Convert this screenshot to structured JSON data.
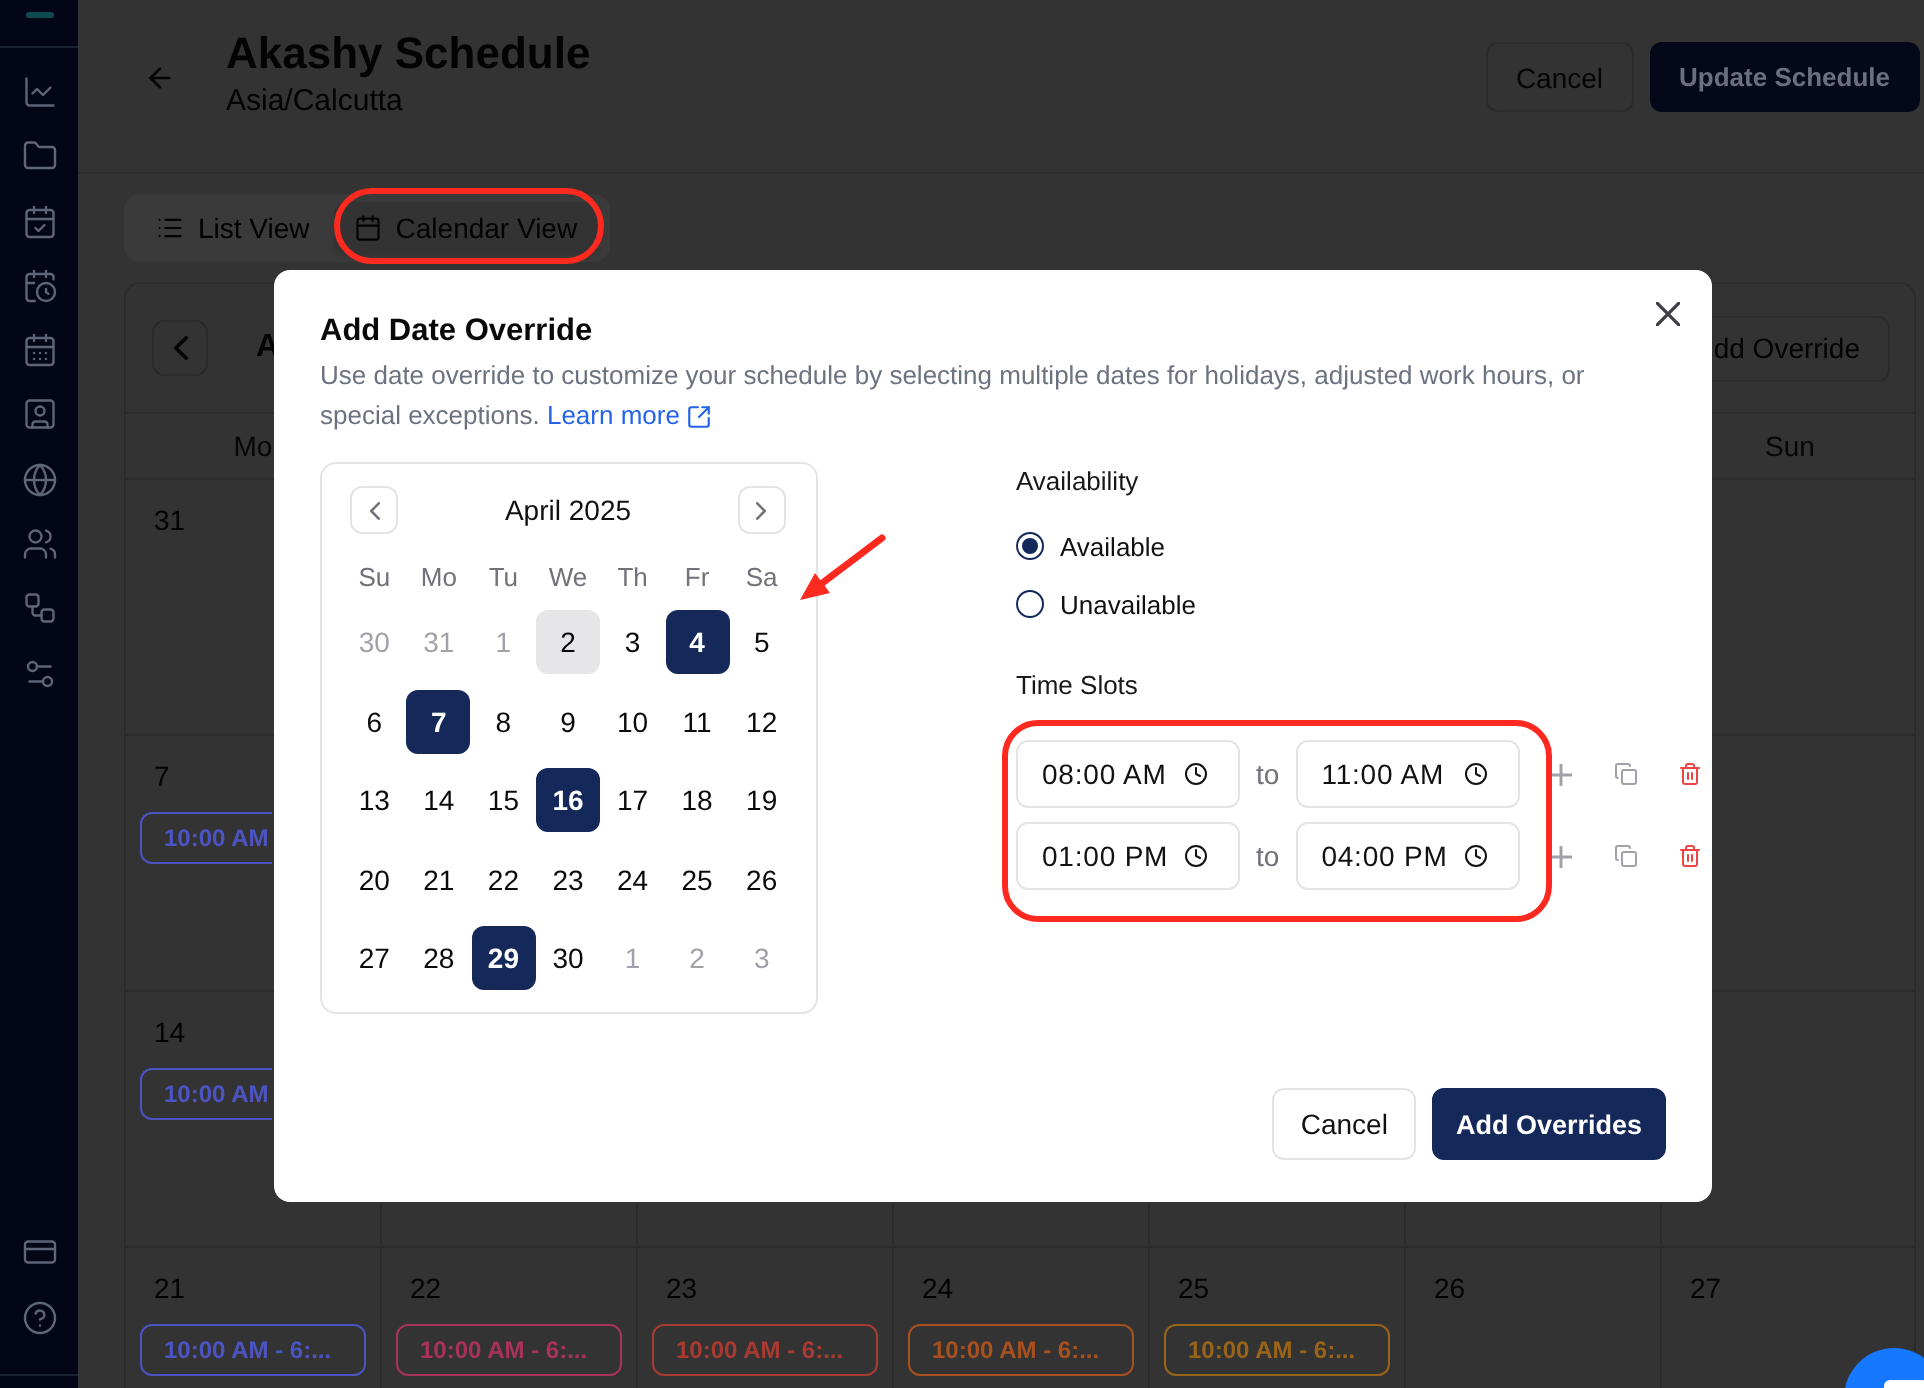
{
  "header": {
    "title": "Akashy Schedule",
    "subtitle": "Asia/Calcutta",
    "buttons": [
      {
        "label": "Cancel",
        "kind": "secondary"
      },
      {
        "label": "Update Schedule",
        "kind": "primary"
      }
    ]
  },
  "view_tabs": [
    {
      "label": "List View",
      "selected": false,
      "circled": false
    },
    {
      "label": "Calendar View",
      "selected": true,
      "circled": true
    }
  ],
  "calendar": {
    "month_title": "A",
    "add_button": "dd Override",
    "weekday_headers": [
      {
        "label": "Mo"
      },
      {
        "label": "Sun"
      }
    ],
    "weeks": [
      {
        "cells": [
          {
            "date": "31"
          },
          {},
          {},
          {},
          {},
          {},
          {}
        ]
      },
      {
        "cells": [
          {
            "date": "7",
            "events": [
              {
                "text": "10:00 AM",
                "color": "#4c54c4",
                "clipped": true
              }
            ]
          },
          {},
          {},
          {},
          {},
          {},
          {}
        ]
      },
      {
        "cells": [
          {
            "date": "14",
            "events": [
              {
                "text": "10:00 AM",
                "color": "#4c54c4",
                "clipped": true
              }
            ]
          },
          {},
          {},
          {},
          {},
          {},
          {}
        ]
      },
      {
        "cells": [
          {
            "date": "21",
            "events": [
              {
                "text": "10:00 AM - 6:...",
                "color": "#4c54c4",
                "clipped": false
              }
            ]
          },
          {
            "date": "22",
            "events": [
              {
                "text": "10:00 AM - 6:...",
                "color": "#a8325a",
                "clipped": false
              }
            ]
          },
          {
            "date": "23",
            "events": [
              {
                "text": "10:00 AM - 6:...",
                "color": "#a83a32",
                "clipped": false
              }
            ]
          },
          {
            "date": "24",
            "events": [
              {
                "text": "10:00 AM - 6:...",
                "color": "#a8501e",
                "clipped": false
              }
            ]
          },
          {
            "date": "25",
            "events": [
              {
                "text": "10:00 AM - 6:...",
                "color": "#9a6418",
                "clipped": false
              }
            ]
          },
          {
            "date": "26"
          },
          {
            "date": "27"
          }
        ]
      }
    ]
  },
  "dialog": {
    "title": "Add Date Override",
    "description": "Use date override to customize your schedule by selecting multiple dates for holidays, adjusted work hours, or special exceptions.",
    "link": "Learn more",
    "date_picker": {
      "month": "April 2025",
      "arrow": true,
      "weekdays": [
        "Su",
        "Mo",
        "Tu",
        "We",
        "Th",
        "Fr",
        "Sa"
      ],
      "weeks": [
        {
          "days": [
            {
              "label": "30",
              "outside": true,
              "today": false,
              "selected": false
            },
            {
              "label": "31",
              "outside": true,
              "today": false,
              "selected": false
            },
            {
              "label": "1",
              "outside": true,
              "today": false,
              "selected": false
            },
            {
              "label": "2",
              "outside": false,
              "today": true,
              "selected": false
            },
            {
              "label": "3",
              "outside": false,
              "today": false,
              "selected": false
            },
            {
              "label": "4",
              "outside": false,
              "today": false,
              "selected": true
            },
            {
              "label": "5",
              "outside": false,
              "today": false,
              "selected": false
            }
          ]
        },
        {
          "days": [
            {
              "label": "6",
              "outside": false,
              "today": false,
              "selected": false
            },
            {
              "label": "7",
              "outside": false,
              "today": false,
              "selected": true
            },
            {
              "label": "8",
              "outside": false,
              "today": false,
              "selected": false
            },
            {
              "label": "9",
              "outside": false,
              "today": false,
              "selected": false
            },
            {
              "label": "10",
              "outside": false,
              "today": false,
              "selected": false
            },
            {
              "label": "11",
              "outside": false,
              "today": false,
              "selected": false
            },
            {
              "label": "12",
              "outside": false,
              "today": false,
              "selected": false
            }
          ]
        },
        {
          "days": [
            {
              "label": "13",
              "outside": false,
              "today": false,
              "selected": false
            },
            {
              "label": "14",
              "outside": false,
              "today": false,
              "selected": false
            },
            {
              "label": "15",
              "outside": false,
              "today": false,
              "selected": false
            },
            {
              "label": "16",
              "outside": false,
              "today": false,
              "selected": true
            },
            {
              "label": "17",
              "outside": false,
              "today": false,
              "selected": false
            },
            {
              "label": "18",
              "outside": false,
              "today": false,
              "selected": false
            },
            {
              "label": "19",
              "outside": false,
              "today": false,
              "selected": false
            }
          ]
        },
        {
          "days": [
            {
              "label": "20",
              "outside": false,
              "today": false,
              "selected": false
            },
            {
              "label": "21",
              "outside": false,
              "today": false,
              "selected": false
            },
            {
              "label": "22",
              "outside": false,
              "today": false,
              "selected": false
            },
            {
              "label": "23",
              "outside": false,
              "today": false,
              "selected": false
            },
            {
              "label": "24",
              "outside": false,
              "today": false,
              "selected": false
            },
            {
              "label": "25",
              "outside": false,
              "today": false,
              "selected": false
            },
            {
              "label": "26",
              "outside": false,
              "today": false,
              "selected": false
            }
          ]
        },
        {
          "days": [
            {
              "label": "27",
              "outside": false,
              "today": false,
              "selected": false
            },
            {
              "label": "28",
              "outside": false,
              "today": false,
              "selected": false
            },
            {
              "label": "29",
              "outside": false,
              "today": false,
              "selected": true
            },
            {
              "label": "30",
              "outside": false,
              "today": false,
              "selected": false
            },
            {
              "label": "1",
              "outside": true,
              "today": false,
              "selected": false
            },
            {
              "label": "2",
              "outside": true,
              "today": false,
              "selected": false
            },
            {
              "label": "3",
              "outside": true,
              "today": false,
              "selected": false
            }
          ]
        }
      ]
    },
    "availability": {
      "label": "Availability",
      "options": [
        {
          "label": "Available",
          "selected": true
        },
        {
          "label": "Unavailable",
          "selected": false
        }
      ]
    },
    "time_slots": {
      "label": "Time Slots",
      "circled": true,
      "rows": [
        {
          "start": "08:00 AM",
          "separator": "to",
          "end": "11:00 AM"
        },
        {
          "start": "01:00 PM",
          "separator": "to",
          "end": "04:00 PM"
        }
      ]
    },
    "buttons": [
      {
        "label": "Cancel",
        "kind": "secondary"
      },
      {
        "label": "Add Overrides",
        "kind": "primary"
      }
    ]
  }
}
